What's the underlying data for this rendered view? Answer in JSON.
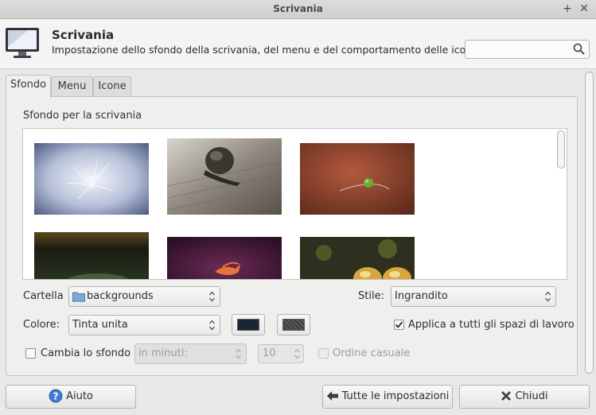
{
  "window": {
    "title": "Scrivania"
  },
  "header": {
    "title": "Scrivania",
    "subtitle": "Impostazione dello sfondo della scrivania, del menu e del comportamento delle icone",
    "search_value": ""
  },
  "tabs": [
    {
      "label": "Sfondo",
      "active": true
    },
    {
      "label": "Menu",
      "active": false
    },
    {
      "label": "Icone",
      "active": false
    }
  ],
  "background": {
    "section_label": "Sfondo per la scrivania",
    "wallpapers": [
      "dandelion",
      "snail",
      "plant sprout",
      "dark field",
      "pink fish",
      "golden mushrooms"
    ]
  },
  "controls": {
    "folder_label": "Cartella",
    "folder_value": "backgrounds",
    "style_label": "Stile:",
    "style_value": "Ingrandito",
    "color_label": "Colore:",
    "color_value": "Tinta unita",
    "primary_color": "#1b2535",
    "apply_all_label": "Applica a tutti gli spazi di lavoro",
    "apply_all_checked": true,
    "change_label": "Cambia lo sfondo",
    "change_checked": false,
    "interval_unit": "in minuti:",
    "interval_value": "10",
    "random_label": "Ordine casuale",
    "random_checked": false
  },
  "buttons": {
    "help": "Aiuto",
    "all_settings": "Tutte le impostazioni",
    "close": "Chiudi"
  }
}
